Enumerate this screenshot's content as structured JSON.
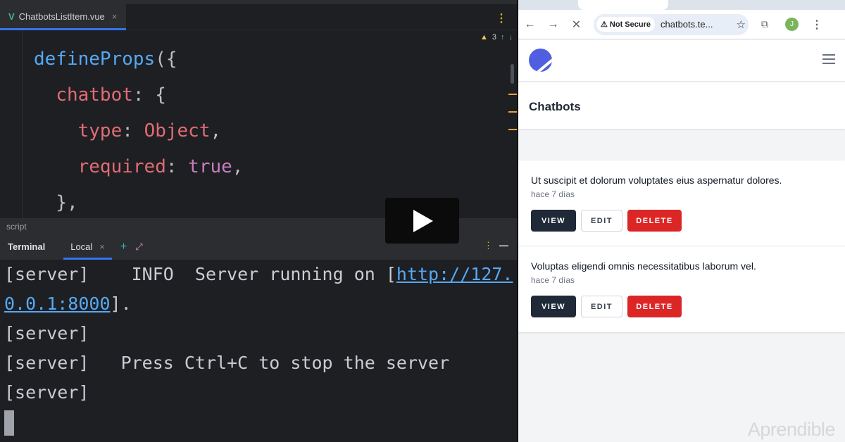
{
  "editor": {
    "tab_label": "ChatbotsListItem.vue",
    "warnings": "3",
    "lines": [
      [
        "defineProps",
        "({"
      ],
      [
        "chatbot",
        ": {"
      ],
      [
        "type",
        ": ",
        "Object",
        ","
      ],
      [
        "required",
        ": ",
        "true",
        ","
      ],
      [
        "},"
      ]
    ],
    "breadcrumb": "script"
  },
  "terminal": {
    "title": "Terminal",
    "tab": "Local",
    "lines": {
      "l1a": "[server]    INFO  Server running on [",
      "link": "http://127.0.0.1:8000",
      "l1b": "].",
      "l2": "[server]",
      "l3": "[server]   Press Ctrl+C to stop the server",
      "l4": "[server]"
    }
  },
  "browser": {
    "security": "Not Secure",
    "url": "chatbots.te...",
    "avatar": "J"
  },
  "page": {
    "title": "Chatbots",
    "items": [
      {
        "title": "Ut suscipit et dolorum voluptates eius aspernatur dolores.",
        "date": "hace 7 días"
      },
      {
        "title": "Voluptas eligendi omnis necessitatibus laborum vel.",
        "date": "hace 7 días"
      }
    ],
    "view": "VIEW",
    "edit": "EDIT",
    "delete": "DELETE"
  },
  "watermark": "Aprendible"
}
